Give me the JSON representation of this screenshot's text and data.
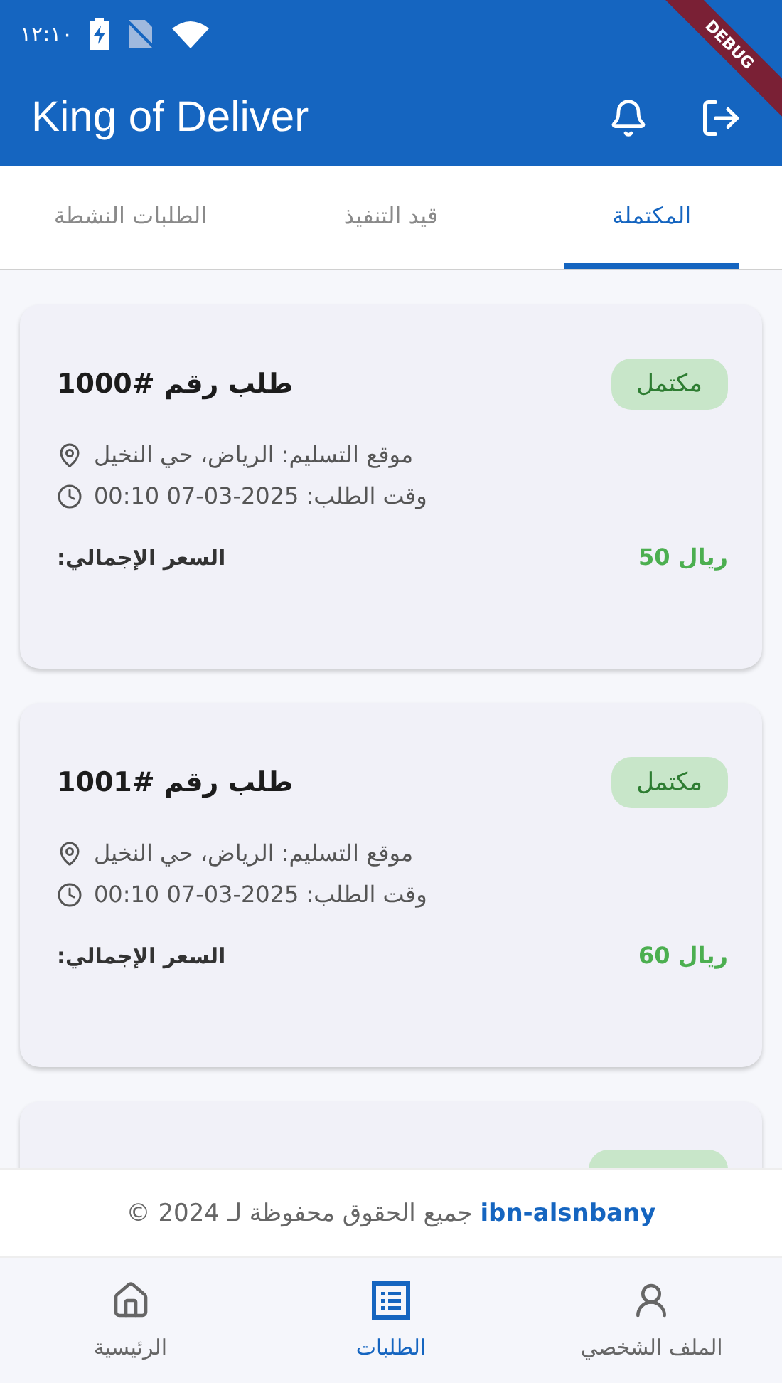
{
  "status_bar": {
    "time": "١٢:١٠"
  },
  "debug_banner": "DEBUG",
  "app_bar": {
    "title": "King of Deliver"
  },
  "tabs": [
    {
      "label": "المكتملة",
      "selected": true
    },
    {
      "label": "قيد التنفيذ",
      "selected": false
    },
    {
      "label": "الطلبات النشطة",
      "selected": false
    }
  ],
  "orders": [
    {
      "kind": "full",
      "title": "طلب رقم #1000",
      "status": "مكتمل",
      "location": "موقع التسليم: الرياض، حي النخيل",
      "time": "وقت الطلب: 2025-03-07 00:10",
      "price": "ريال 50",
      "price_label": "السعر الإجمالي:"
    },
    {
      "kind": "full",
      "title": "طلب رقم #1001",
      "status": "مكتمل",
      "location": "موقع التسليم: الرياض، حي النخيل",
      "time": "وقت الطلب: 2025-03-07 00:10",
      "price": "ريال 60",
      "price_label": "السعر الإجمالي:"
    },
    {
      "kind": "cut"
    }
  ],
  "footer": "**ibn-alsnbany** جميع الحقوق محفوظة لـ 2024 ©",
  "bottom_nav": [
    {
      "kind": "profile",
      "label": "الملف الشخصي",
      "selected": false
    },
    {
      "kind": "orders",
      "label": "الطلبات",
      "selected": true
    },
    {
      "kind": "home",
      "label": "الرئيسية",
      "selected": false
    }
  ]
}
